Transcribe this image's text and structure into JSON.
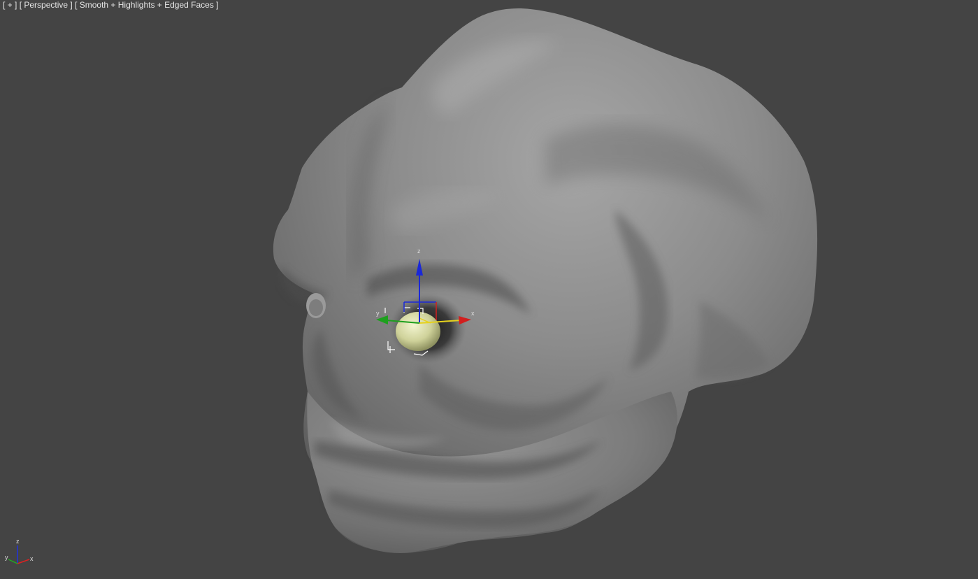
{
  "viewport": {
    "label_plus": "[ + ]",
    "label_view": "[ Perspective ]",
    "label_shading": "[ Smooth + Highlights + Edged Faces ]",
    "background_color": "#444444"
  },
  "gizmo": {
    "axis_x": "x",
    "axis_y": "y",
    "axis_z": "z",
    "color_x": "#d21e1e",
    "color_y": "#1ea01e",
    "color_z": "#1a28d8",
    "plane_color": "#e6d21e"
  },
  "world_axis": {
    "axis_x": "x",
    "axis_y": "y",
    "axis_z": "z"
  },
  "scene": {
    "object": "sculpted-head-mesh",
    "selected_object": "eyeball",
    "mesh_color": "#8a8a8a",
    "eyeball_color": "#d9dcaa"
  }
}
